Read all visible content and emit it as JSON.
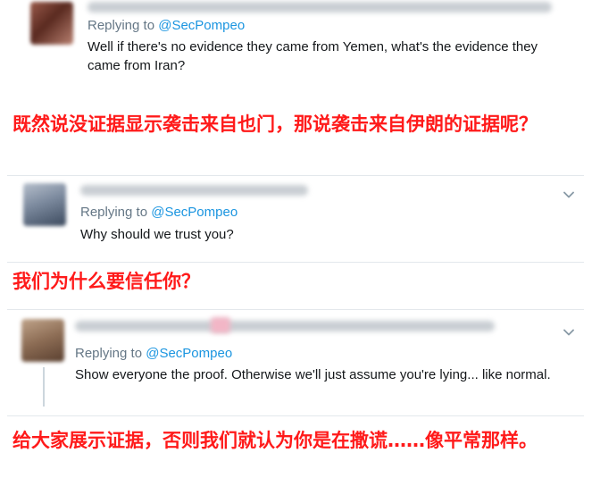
{
  "tweets": [
    {
      "replying_prefix": "Replying to ",
      "handle": "@SecPompeo",
      "text": "Well if there's no evidence they came from Yemen, what's the evidence they came from Iran?",
      "translation": "既然说没证据显示袭击来自也门，那说袭击来自伊朗的证据呢？"
    },
    {
      "replying_prefix": "Replying to ",
      "handle": "@SecPompeo",
      "text": "Why should we trust you?",
      "translation": "我们为什么要信任你？"
    },
    {
      "replying_prefix": "Replying to ",
      "handle": "@SecPompeo",
      "text": "Show everyone the proof. Otherwise we'll just assume you're lying... like normal.",
      "translation": "给大家展示证据，否则我们就认为你是在撒谎……像平常那样。"
    }
  ],
  "icons": {
    "more": "chevron-down-icon"
  },
  "colors": {
    "translation_red": "#ff1a1a",
    "handle_blue": "#1b95e0",
    "meta_gray": "#657786"
  }
}
